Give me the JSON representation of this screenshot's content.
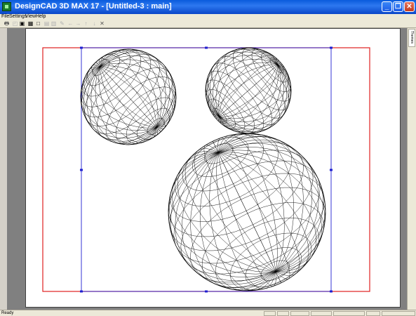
{
  "window": {
    "title": "DesignCAD 3D MAX 17 - [Untitled-3 : main]",
    "minimize_label": "_",
    "maximize_label": "❐",
    "close_label": "✕"
  },
  "menu": {
    "items": [
      {
        "id": "file",
        "label": "File"
      },
      {
        "id": "settings",
        "label": "Settings"
      },
      {
        "id": "view",
        "label": "View"
      },
      {
        "id": "help",
        "label": "Help"
      }
    ]
  },
  "toolbar": {
    "buttons": [
      {
        "id": "print",
        "glyph": "🖶",
        "state": "normal"
      },
      {
        "id": "print-preview",
        "glyph": "◰",
        "state": "disabled"
      },
      {
        "id": "page",
        "glyph": "▣",
        "state": "active"
      },
      {
        "id": "layout",
        "glyph": "▦",
        "state": "active"
      },
      {
        "id": "frame",
        "glyph": "□",
        "state": "active"
      },
      {
        "id": "group1",
        "glyph": "▤",
        "state": "disabled"
      },
      {
        "id": "group2",
        "glyph": "▥",
        "state": "disabled"
      },
      {
        "id": "draw",
        "glyph": "✎",
        "state": "disabled"
      },
      {
        "id": "arrow-left",
        "glyph": "←",
        "state": "disabled"
      },
      {
        "id": "arrow-right",
        "glyph": "→",
        "state": "disabled"
      },
      {
        "id": "arrow-up",
        "glyph": "↑",
        "state": "disabled"
      },
      {
        "id": "arrow-down",
        "glyph": "↓",
        "state": "disabled"
      },
      {
        "id": "delete",
        "glyph": "✕",
        "state": "normal"
      }
    ]
  },
  "side_panel": {
    "tab_label": "Themes"
  },
  "status": {
    "text": "Ready"
  },
  "colors": {
    "title_blue": "#0a5bdc",
    "selection": "#2020d0",
    "border_red": "#e02020",
    "workspace": "#808080"
  }
}
